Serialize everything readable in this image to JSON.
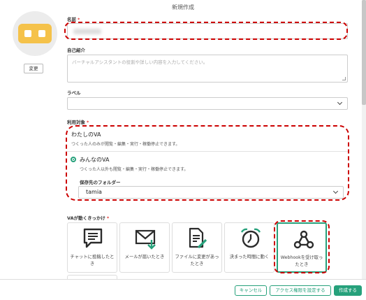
{
  "dialog": {
    "title": "新規作成"
  },
  "avatar": {
    "change_label": "変更",
    "color": "#f5c24a"
  },
  "fields": {
    "name_label": "名前",
    "required_mark": "*",
    "intro_label": "自己紹介",
    "intro_placeholder": "バーチャルアシスタントの役割や詳しい内容を入力してください。",
    "label_label": "ラベル",
    "label_value": "",
    "usage_label": "利用対象"
  },
  "usage_options": [
    {
      "title": "わたしのVA",
      "desc": "つくった人のみが閲覧・編集・実行・稼働停止できます。",
      "selected": false
    },
    {
      "title": "みんなのVA",
      "desc": "つくった人以外も閲覧・編集・実行・稼働停止できます。",
      "selected": true
    }
  ],
  "folder": {
    "label": "保存先のフォルダー",
    "value": "tamia"
  },
  "triggers": {
    "label": "VAが動くきっかけ",
    "items": [
      {
        "label": "チャットに投稿したとき",
        "icon": "chat-icon"
      },
      {
        "label": "メールが届いたとき",
        "icon": "mail-icon"
      },
      {
        "label": "ファイルに変更があったとき",
        "icon": "file-edit-icon"
      },
      {
        "label": "決まった時間に動く",
        "icon": "alarm-clock-icon"
      },
      {
        "label": "Webhookを受け取ったとき",
        "icon": "webhook-icon",
        "selected": true
      }
    ]
  },
  "footer": {
    "cancel": "キャンセル",
    "access": "アクセス権限を設定する",
    "create": "作成する"
  },
  "colors": {
    "accent": "#26a17b",
    "highlight": "#cc0000",
    "required": "#e53935"
  }
}
